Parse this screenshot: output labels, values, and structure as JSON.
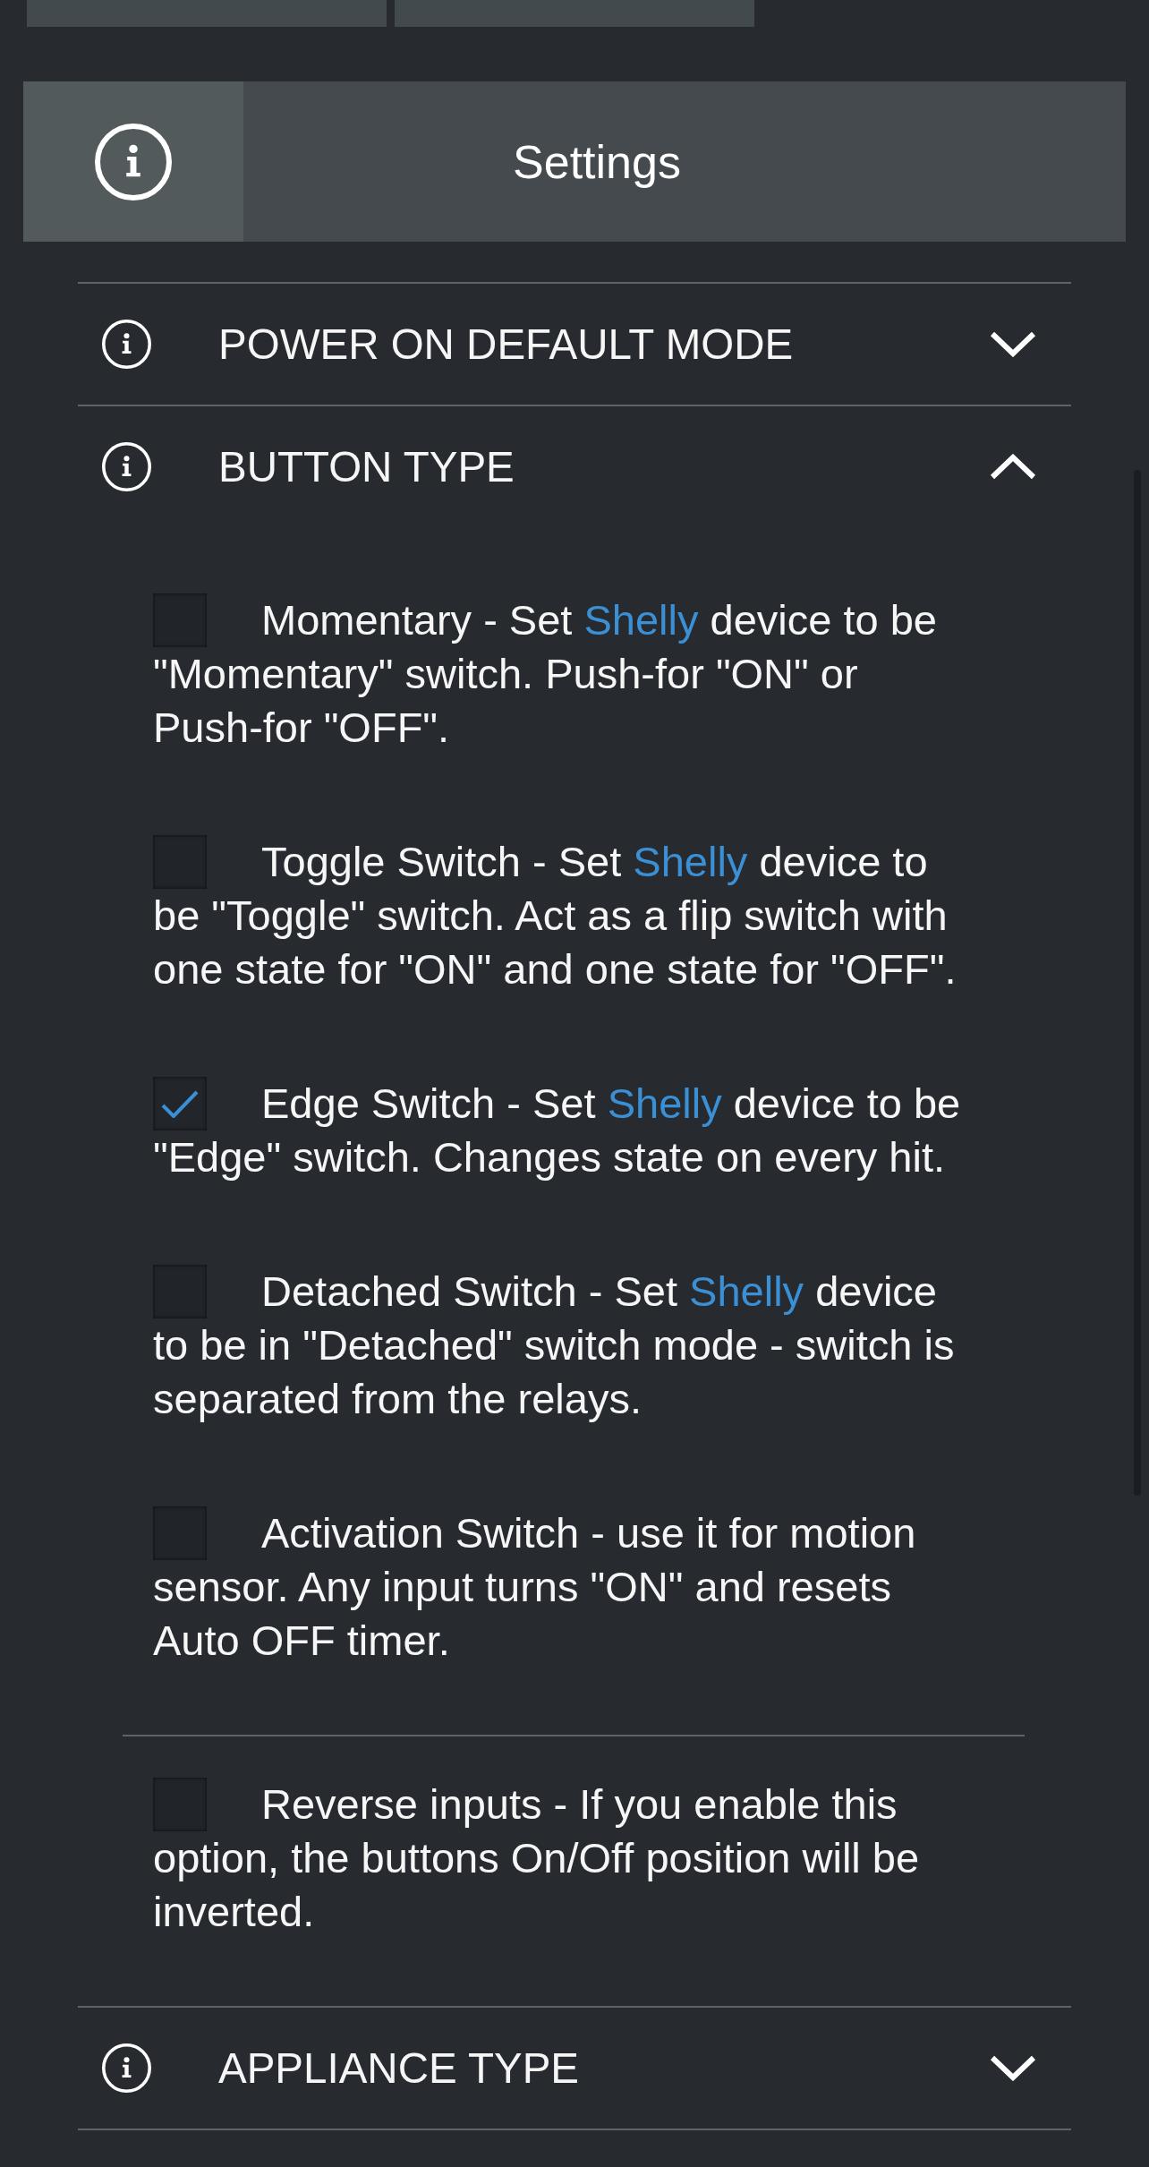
{
  "header": {
    "title": "Settings"
  },
  "sections": [
    {
      "title": "POWER ON DEFAULT MODE",
      "expanded": false
    },
    {
      "title": "BUTTON TYPE",
      "expanded": true,
      "groups": [
        {
          "options": [
            {
              "checked": false,
              "parts": [
                {
                  "kind": "text",
                  "text": "Momentary - Set "
                },
                {
                  "kind": "link",
                  "text": "Shelly"
                },
                {
                  "kind": "text",
                  "text": " device to be \"Momentary\" switch. Push-for \"ON\" or Push-for \"OFF\"."
                }
              ]
            },
            {
              "checked": false,
              "parts": [
                {
                  "kind": "text",
                  "text": "Toggle Switch - Set "
                },
                {
                  "kind": "link",
                  "text": "Shelly"
                },
                {
                  "kind": "text",
                  "text": " device to be \"Toggle\" switch. Act as a flip switch with one state for \"ON\" and one state for \"OFF\"."
                }
              ]
            },
            {
              "checked": true,
              "parts": [
                {
                  "kind": "text",
                  "text": "Edge Switch - Set "
                },
                {
                  "kind": "link",
                  "text": "Shelly"
                },
                {
                  "kind": "text",
                  "text": " device to be \"Edge\" switch. Changes state on every hit."
                }
              ]
            },
            {
              "checked": false,
              "parts": [
                {
                  "kind": "text",
                  "text": "Detached Switch - Set "
                },
                {
                  "kind": "link",
                  "text": "Shelly"
                },
                {
                  "kind": "text",
                  "text": " device to be in \"Detached\" switch mode - switch is separated from the relays."
                }
              ]
            },
            {
              "checked": false,
              "parts": [
                {
                  "kind": "text",
                  "text": "Activation Switch - use it for motion sensor. Any input turns \"ON\" and resets Auto OFF timer."
                }
              ]
            }
          ]
        },
        {
          "options": [
            {
              "checked": false,
              "parts": [
                {
                  "kind": "text",
                  "text": "Reverse inputs - If you enable this option, the buttons On/Off position will be inverted."
                }
              ]
            }
          ]
        }
      ]
    },
    {
      "title": "APPLIANCE TYPE",
      "expanded": false
    }
  ]
}
